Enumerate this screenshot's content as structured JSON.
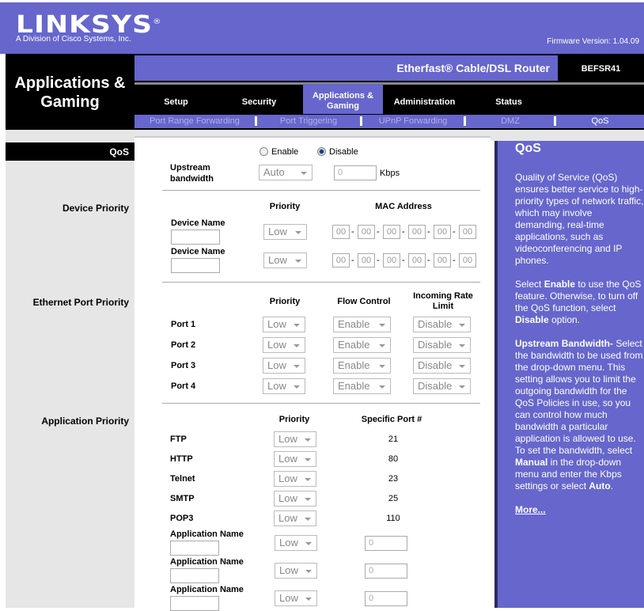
{
  "header": {
    "logo": "LINKSYS",
    "division": "A Division of Cisco Systems, Inc.",
    "firmware": "Firmware Version: 1.04.09",
    "section": "Applications & Gaming",
    "product": "Etherfast® Cable/DSL Router",
    "model": "BEFSR41"
  },
  "tabs": [
    {
      "label": "Setup"
    },
    {
      "label": "Security"
    },
    {
      "label": "Applications & Gaming",
      "active": true
    },
    {
      "label": "Administration"
    },
    {
      "label": "Status"
    }
  ],
  "subtabs": [
    {
      "label": "Port Range Forwarding"
    },
    {
      "label": "Port Triggering"
    },
    {
      "label": "UPnP Forwarding"
    },
    {
      "label": "DMZ"
    },
    {
      "label": "QoS",
      "active": true
    }
  ],
  "left": {
    "qos": "QoS",
    "device_priority": "Device Priority",
    "ethernet_priority": "Ethernet Port Priority",
    "application_priority": "Application Priority"
  },
  "qos": {
    "enable": "Enable",
    "disable": "Disable",
    "selected": "Disable",
    "upstream_label": "Upstream bandwidth",
    "upstream_value": "Auto",
    "kbps_value": "0",
    "kbps_unit": "Kbps"
  },
  "device": {
    "priority_header": "Priority",
    "mac_header": "MAC Address",
    "rows": [
      {
        "label": "Device Name",
        "name": "",
        "priority": "Low",
        "mac": [
          "00",
          "00",
          "00",
          "00",
          "00",
          "00"
        ]
      },
      {
        "label": "Device Name",
        "name": "",
        "priority": "Low",
        "mac": [
          "00",
          "00",
          "00",
          "00",
          "00",
          "00"
        ]
      }
    ]
  },
  "ethernet": {
    "priority_header": "Priority",
    "flow_header": "Flow Control",
    "rate_header": "Incoming Rate Limit",
    "rows": [
      {
        "port": "Port 1",
        "priority": "Low",
        "flow": "Enable",
        "rate": "Disable"
      },
      {
        "port": "Port 2",
        "priority": "Low",
        "flow": "Enable",
        "rate": "Disable"
      },
      {
        "port": "Port 3",
        "priority": "Low",
        "flow": "Enable",
        "rate": "Disable"
      },
      {
        "port": "Port 4",
        "priority": "Low",
        "flow": "Enable",
        "rate": "Disable"
      }
    ]
  },
  "application": {
    "priority_header": "Priority",
    "port_header": "Specific Port #",
    "rows": [
      {
        "name": "FTP",
        "priority": "Low",
        "port": "21"
      },
      {
        "name": "HTTP",
        "priority": "Low",
        "port": "80"
      },
      {
        "name": "Telnet",
        "priority": "Low",
        "port": "23"
      },
      {
        "name": "SMTP",
        "priority": "Low",
        "port": "25"
      },
      {
        "name": "POP3",
        "priority": "Low",
        "port": "110"
      }
    ],
    "custom": [
      {
        "label": "Application Name",
        "name": "",
        "priority": "Low",
        "port": "0"
      },
      {
        "label": "Application Name",
        "name": "",
        "priority": "Low",
        "port": "0"
      },
      {
        "label": "Application Name",
        "name": "",
        "priority": "Low",
        "port": "0"
      }
    ]
  },
  "help": {
    "title": "QoS",
    "p1": "Quality of Service (QoS) ensures better service to high-priority types of network traffic, which may involve demanding, real-time applications, such as videoconferencing and IP phones.",
    "p2a": "Select ",
    "p2b": "Enable",
    "p2c": " to use the QoS feature.  Otherwise, to turn off the QoS function, select ",
    "p2d": "Disable",
    "p2e": " option.",
    "p3a": "Upstream Bandwidth-",
    "p3b": " Select the bandwidth to be used from the drop-down menu.  This setting allows you to limit the outgoing bandwidth for the QoS Policies in use, so you can control how much bandwidth a particular application is allowed to use.  To set the bandwidth, select ",
    "p3c": "Manual",
    "p3d": " in the drop-down menu and enter the Kbps settings or select ",
    "p3e": "Auto",
    "p3f": ".",
    "more": "More..."
  },
  "colors": {
    "brand": "#6666cc",
    "dark": "#000000"
  }
}
